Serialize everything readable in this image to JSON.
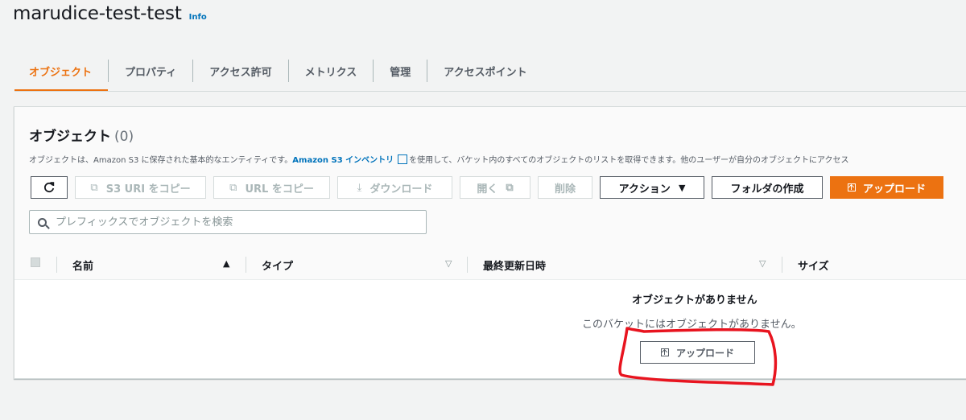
{
  "bucket": {
    "name": "marudice-test-test",
    "info_label": "Info"
  },
  "tabs": [
    {
      "label": "オブジェクト",
      "active": true
    },
    {
      "label": "プロパティ"
    },
    {
      "label": "アクセス許可"
    },
    {
      "label": "メトリクス"
    },
    {
      "label": "管理"
    },
    {
      "label": "アクセスポイント"
    }
  ],
  "objects_panel": {
    "title": "オブジェクト",
    "count": "(0)",
    "description_prefix": "オブジェクトは、Amazon S3 に保存された基本的なエンティティです。",
    "description_link": "Amazon S3 インベントリ",
    "description_suffix": "を使用して、バケット内のすべてのオブジェクトのリストを取得できます。他のユーザーが自分のオブジェクトにアクセス"
  },
  "toolbar": {
    "copy_s3_uri": "S3 URI をコピー",
    "copy_url": "URL をコピー",
    "download": "ダウンロード",
    "open": "開く",
    "delete": "削除",
    "actions": "アクション",
    "create_folder": "フォルダの作成",
    "upload": "アップロード"
  },
  "search": {
    "placeholder": "プレフィックスでオブジェクトを検索"
  },
  "table": {
    "columns": [
      {
        "label": "名前",
        "sort": "▲"
      },
      {
        "label": "タイプ",
        "sort": "▽"
      },
      {
        "label": "最終更新日時",
        "sort": "▽"
      },
      {
        "label": "サイズ"
      }
    ]
  },
  "empty_state": {
    "heading": "オブジェクトがありません",
    "message": "このバケットにはオブジェクトがありません。",
    "upload_label": "アップロード"
  },
  "colors": {
    "accent": "#ec7211",
    "link": "#0073bb",
    "annotation": "#e8141f"
  },
  "icons": [
    "refresh-icon",
    "copy-icon",
    "download-icon",
    "external-link-icon",
    "caret-down-icon",
    "upload-icon",
    "search-icon"
  ]
}
